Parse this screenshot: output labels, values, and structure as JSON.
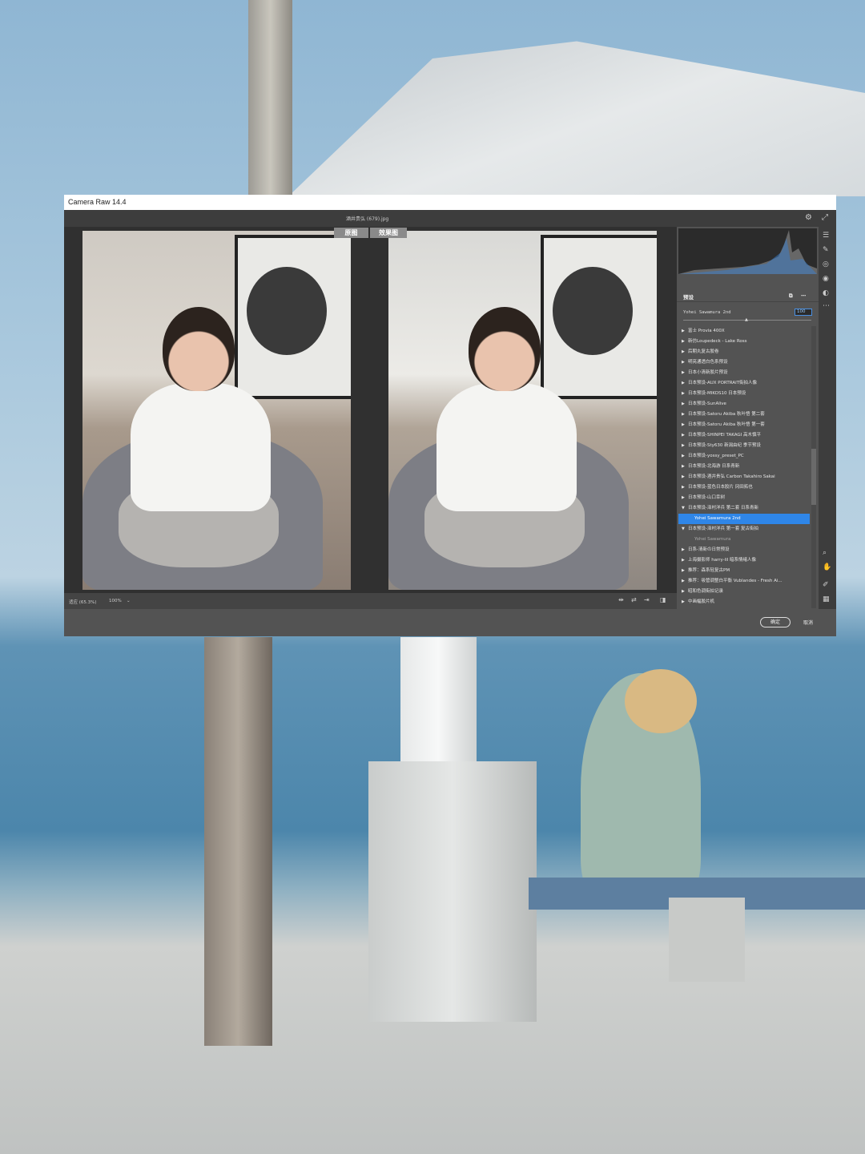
{
  "window": {
    "title": "Camera Raw 14.4",
    "filename": "酒井贵弘 (679).jpg"
  },
  "preview": {
    "before_label": "原图",
    "after_label": "效果图"
  },
  "status": {
    "fit": "适应 (65.3%)",
    "zoom": "100%"
  },
  "panel": {
    "title": "预设",
    "slider_label": "Yohei Sawamura 2nd",
    "amount": "100",
    "items": [
      {
        "label": "富士 Provia 400X",
        "arrow": "▶"
      },
      {
        "label": "新仿Loupedeck - Lake Ross",
        "arrow": "▶"
      },
      {
        "label": "后期丸复古胶卷",
        "arrow": "▶"
      },
      {
        "label": "明亮通透白色系预设",
        "arrow": "▶"
      },
      {
        "label": "日本小清新胶片预设",
        "arrow": "▶"
      },
      {
        "label": "日本预设-AUX PORTRAIT街拍人像",
        "arrow": "▶"
      },
      {
        "label": "日本预设-MIKOS10 日本预设",
        "arrow": "▶"
      },
      {
        "label": "日本预设-SunAlive",
        "arrow": "▶"
      },
      {
        "label": "日本预设-Satoru Akiba 秋叶悟 第二套",
        "arrow": "▶"
      },
      {
        "label": "日本预设-Satoru Akiba 秋叶悟 第一套",
        "arrow": "▶"
      },
      {
        "label": "日本预设-SHINPEI TAKAGI 高木慎平",
        "arrow": "▶"
      },
      {
        "label": "日本预设-Sty630 新潟由纪 季节预设",
        "arrow": "▶"
      },
      {
        "label": "日本预设-yossy_preset_PC",
        "arrow": "▶"
      },
      {
        "label": "日本预设-北海游 日系青新",
        "arrow": "▶"
      },
      {
        "label": "日本预设-酒井贵弘 Carbon Takahiro Sakai",
        "arrow": "▶"
      },
      {
        "label": "日本预设-蓝色日本胶片 冈田拓也",
        "arrow": "▶"
      },
      {
        "label": "日本预设-山口幸树",
        "arrow": "▶"
      },
      {
        "label": "日本预设-泽村洋兵 第二套 日系青新",
        "arrow": "▼"
      },
      {
        "label": "Yohei Sawamura 2nd",
        "arrow": "",
        "child": true,
        "selected": true
      },
      {
        "label": "日本预设-泽村洋兵 第一套 复古街拍",
        "arrow": "▼"
      },
      {
        "label": "Yohei Sawamura",
        "arrow": "",
        "child": true
      },
      {
        "label": "日系-清新の日常预设",
        "arrow": "▶"
      },
      {
        "label": "上海摄影师 harry-lil 暗系情绪人像",
        "arrow": "▶"
      },
      {
        "label": "推荐：森系轻复古PM",
        "arrow": "▶"
      },
      {
        "label": "推荐：吸管调整白平衡 Vublandes - Fresh Ai...",
        "arrow": "▶"
      },
      {
        "label": "昭和色调街拍记录",
        "arrow": "▶"
      },
      {
        "label": "中画幅胶片机",
        "arrow": "▶"
      }
    ]
  },
  "buttons": {
    "ok": "确定",
    "cancel": "取消"
  },
  "colors": {
    "accent": "#2f86e8"
  }
}
